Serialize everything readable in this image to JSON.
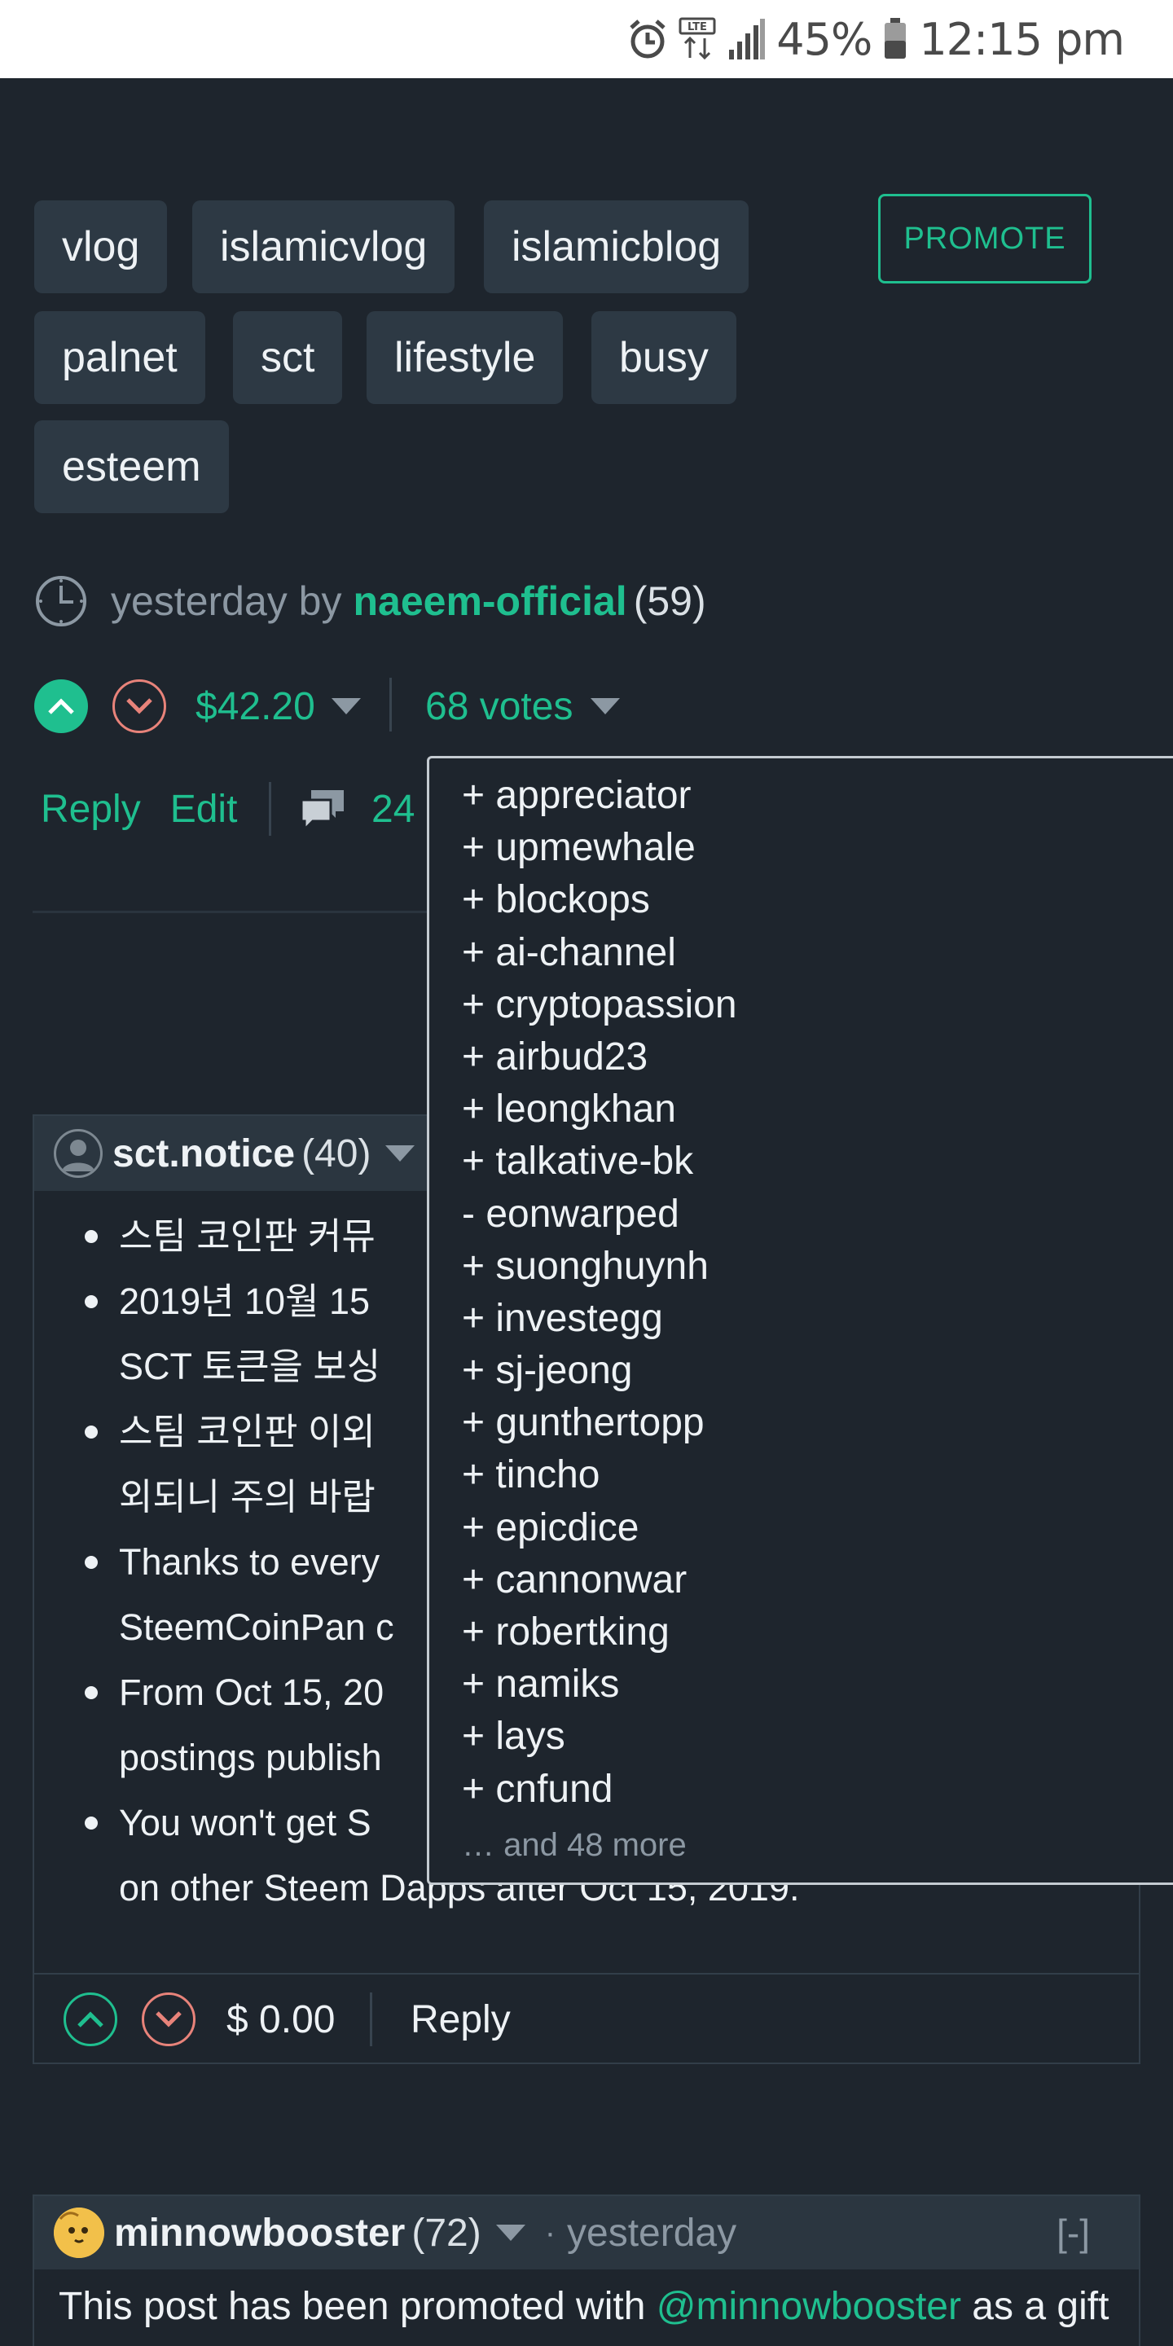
{
  "status_bar": {
    "battery": "45%",
    "time": "12:15 pm",
    "icons": [
      "alarm-icon",
      "lte-icon",
      "signal-icon",
      "battery-icon"
    ]
  },
  "tags": [
    "vlog",
    "islamicvlog",
    "islamicblog",
    "palnet",
    "sct",
    "lifestyle",
    "busy",
    "esteem"
  ],
  "promote_label": "PROMOTE",
  "post_meta": {
    "when": "yesterday by",
    "author": "naeem-official",
    "reputation": "(59)"
  },
  "post_vote": {
    "payout": "$42.20",
    "votes_label": "68 votes"
  },
  "post_actions": {
    "reply": "Reply",
    "edit": "Edit",
    "comment_count": "24"
  },
  "votes_dropdown": {
    "voters": [
      "+ appreciator",
      "+ upmewhale",
      "+ blockops",
      "+ ai-channel",
      "+ cryptopassion",
      "+ airbud23",
      "+ leongkhan",
      "+ talkative-bk",
      "- eonwarped",
      "+ suonghuynh",
      "+ investegg",
      "+ sj-jeong",
      "+ gunthertopp",
      "+ tincho",
      "+ epicdice",
      "+ cannonwar",
      "+ robertking",
      "+ namiks",
      "+ lays",
      "+ cnfund"
    ],
    "more": "… and 48 more"
  },
  "comment1": {
    "username": "sct.notice",
    "reputation": "(40)",
    "bullets": [
      "스팀 코인판 커뮤",
      "2019년 10월 15",
      "SCT 토큰을 보싱",
      "스팀 코인판 이외",
      "외되니 주의 바랍",
      "Thanks to every",
      "SteemCoinPan c",
      "From Oct 15, 20",
      "postings publish",
      "You won't get S",
      "on other Steem Dapps after Oct 15, 2019."
    ],
    "payout": "$ 0.00",
    "reply": "Reply"
  },
  "comment2": {
    "username": "minnowbooster",
    "reputation": "(72)",
    "dot": "·",
    "time": "yesterday",
    "collapse": "[-]",
    "text_before": "This post has been promoted with ",
    "link": "@minnowbooster",
    "text_after": " as a gift"
  },
  "colors": {
    "background": "#1e252d",
    "accent": "#1fbf8f",
    "downvote": "#e8837a",
    "tag_bg": "#2d3944"
  }
}
